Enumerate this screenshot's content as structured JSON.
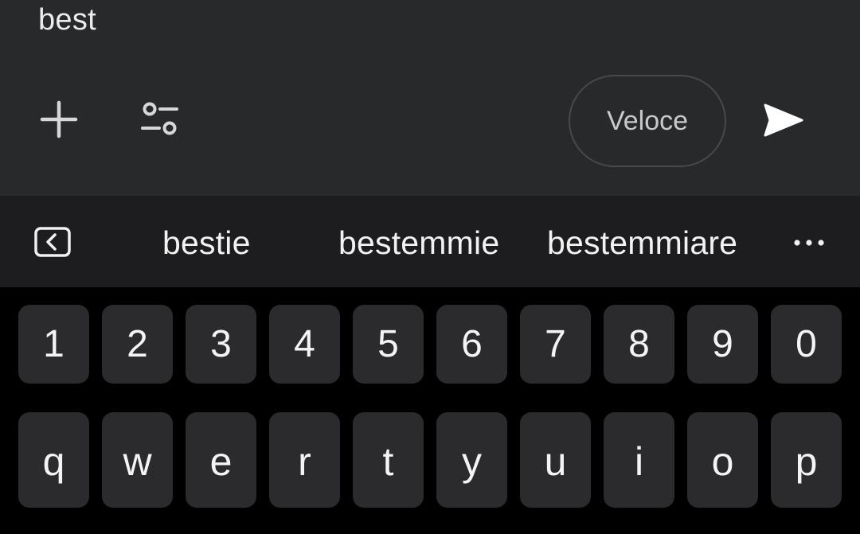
{
  "composer": {
    "text": "best",
    "mode_label": "Veloce",
    "icons": {
      "add": "plus-icon",
      "settings": "sliders-icon",
      "send": "send-arrow-icon"
    }
  },
  "suggestions": {
    "collapse_icon": "collapse-toolbar-icon",
    "items": [
      "bestie",
      "bestemmie",
      "bestemmiare"
    ],
    "more_icon": "more-horizontal-icon"
  },
  "keyboard": {
    "number_row": [
      "1",
      "2",
      "3",
      "4",
      "5",
      "6",
      "7",
      "8",
      "9",
      "0"
    ],
    "letter_row": [
      "q",
      "w",
      "e",
      "r",
      "t",
      "y",
      "u",
      "i",
      "o",
      "p"
    ]
  },
  "colors": {
    "composer_bg": "#28292b",
    "suggest_bg": "#1d1d1f",
    "keyboard_bg": "#000000",
    "key_bg": "#2b2b2d",
    "text": "#f4f4f4"
  }
}
